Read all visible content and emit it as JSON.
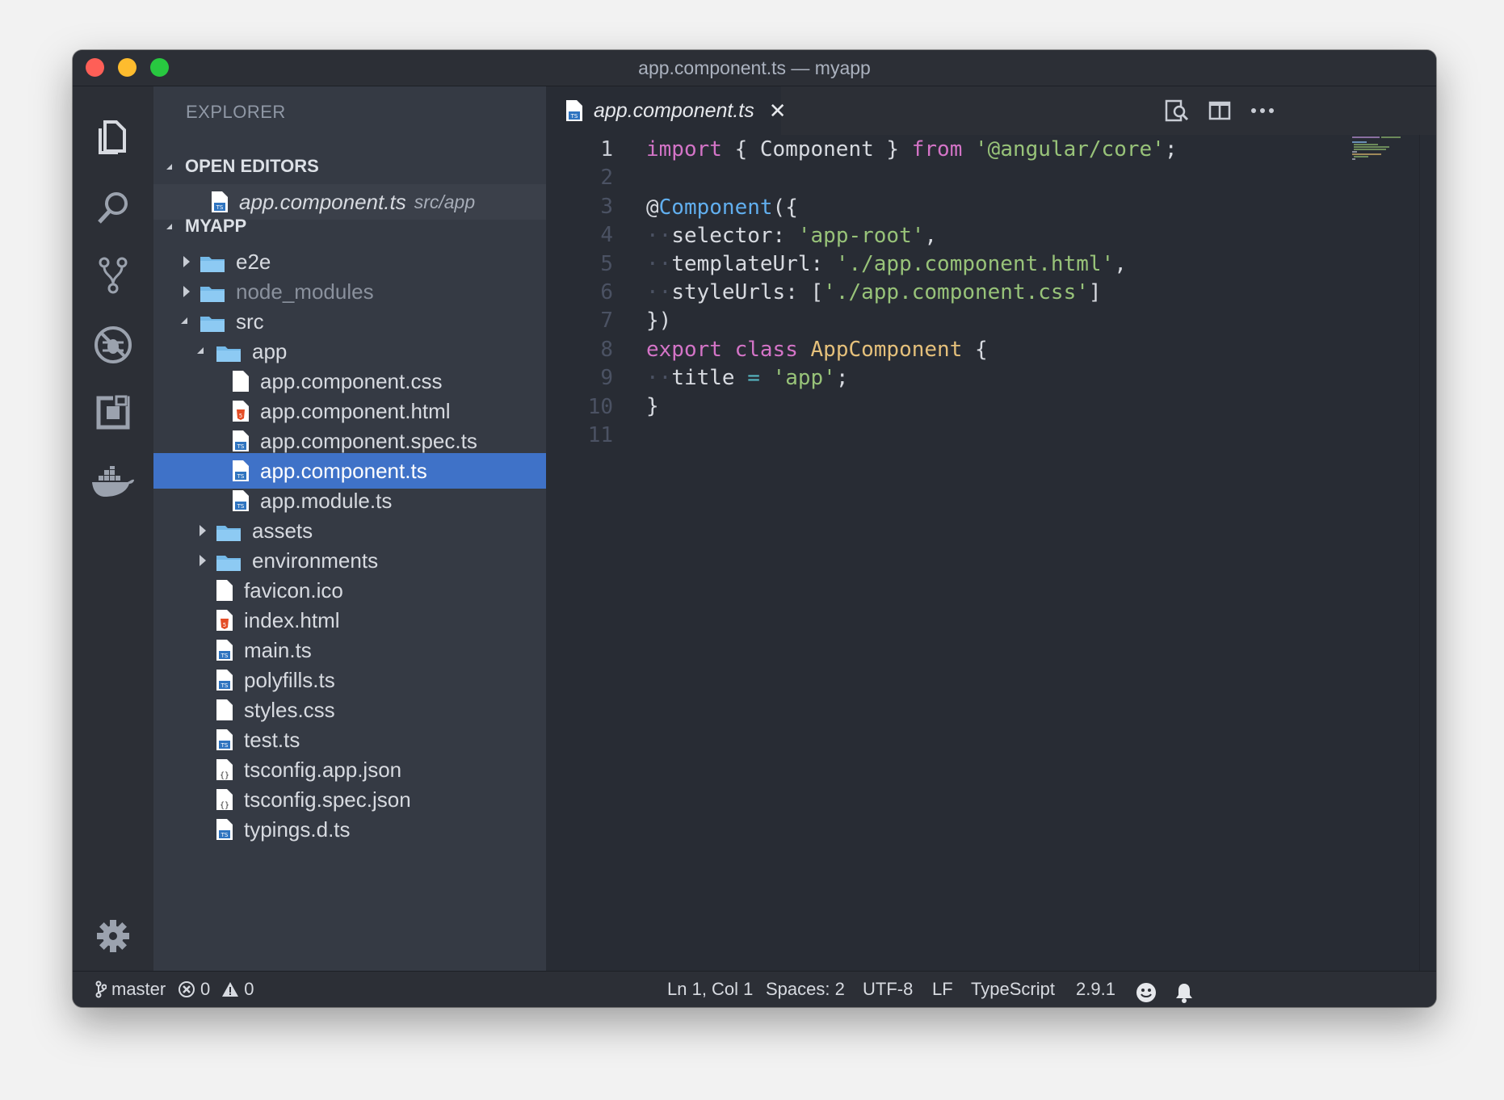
{
  "window": {
    "title": "app.component.ts — myapp"
  },
  "activity_bar": {
    "items": [
      {
        "name": "explorer-icon"
      },
      {
        "name": "search-icon"
      },
      {
        "name": "source-control-icon"
      },
      {
        "name": "debug-icon"
      },
      {
        "name": "extensions-icon"
      },
      {
        "name": "docker-icon"
      }
    ],
    "settings": "gear-icon"
  },
  "sidebar": {
    "title": "EXPLORER",
    "open_editors": {
      "header": "OPEN EDITORS",
      "items": [
        {
          "label": "app.component.ts",
          "description": "src/app"
        }
      ]
    },
    "project": {
      "header": "MYAPP",
      "tree": [
        {
          "label": "e2e",
          "type": "folder"
        },
        {
          "label": "node_modules",
          "type": "folder"
        },
        {
          "label": "src",
          "type": "folder"
        },
        {
          "label": "app",
          "type": "folder"
        },
        {
          "label": "app.component.css",
          "type": "css"
        },
        {
          "label": "app.component.html",
          "type": "html"
        },
        {
          "label": "app.component.spec.ts",
          "type": "ts"
        },
        {
          "label": "app.component.ts",
          "type": "ts"
        },
        {
          "label": "app.module.ts",
          "type": "ts"
        },
        {
          "label": "assets",
          "type": "folder"
        },
        {
          "label": "environments",
          "type": "folder"
        },
        {
          "label": "favicon.ico",
          "type": "file"
        },
        {
          "label": "index.html",
          "type": "html"
        },
        {
          "label": "main.ts",
          "type": "ts"
        },
        {
          "label": "polyfills.ts",
          "type": "ts"
        },
        {
          "label": "styles.css",
          "type": "css"
        },
        {
          "label": "test.ts",
          "type": "ts"
        },
        {
          "label": "tsconfig.app.json",
          "type": "json"
        },
        {
          "label": "tsconfig.spec.json",
          "type": "json"
        },
        {
          "label": "typings.d.ts",
          "type": "ts"
        }
      ]
    }
  },
  "editor": {
    "tab": {
      "label": "app.component.ts",
      "close": "✕"
    },
    "actions": [
      "open-preview-icon",
      "split-editor-icon",
      "more-actions-icon"
    ],
    "line_numbers": [
      "1",
      "2",
      "3",
      "4",
      "5",
      "6",
      "7",
      "8",
      "9",
      "10",
      "11"
    ],
    "code": [
      "import { Component } from '@angular/core';",
      "",
      "@Component({",
      "  selector: 'app-root',",
      "  templateUrl: './app.component.html',",
      "  styleUrls: ['./app.component.css']",
      "})",
      "export class AppComponent {",
      "  title = 'app';",
      "}",
      ""
    ]
  },
  "statusbar": {
    "branch": "master",
    "errors": "0",
    "warnings": "0",
    "position": "Ln 1, Col 1",
    "spaces": "Spaces: 2",
    "encoding": "UTF-8",
    "eol": "LF",
    "language": "TypeScript",
    "version": "2.9.1"
  },
  "colors": {
    "selection": "#3f72c8",
    "keyword": "#d474c7",
    "string": "#98c379",
    "class": "#e5c07b",
    "function": "#61afef"
  }
}
